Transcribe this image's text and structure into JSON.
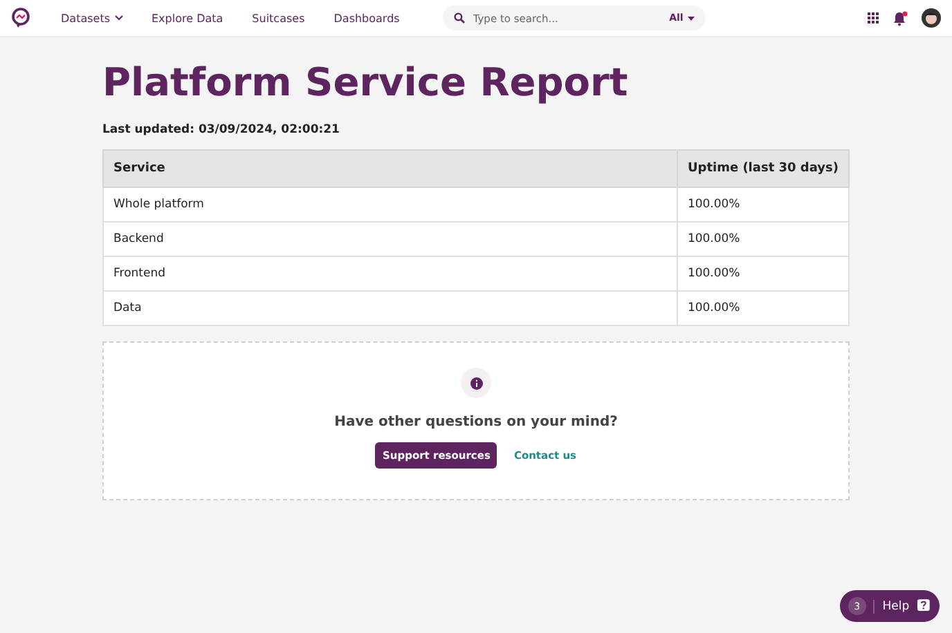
{
  "nav": {
    "items": [
      {
        "label": "Datasets",
        "dropdown": true
      },
      {
        "label": "Explore Data",
        "dropdown": false
      },
      {
        "label": "Suitcases",
        "dropdown": false
      },
      {
        "label": "Dashboards",
        "dropdown": false
      }
    ],
    "search": {
      "placeholder": "Type to search...",
      "scope": "All"
    }
  },
  "title": "Platform Service Report",
  "updated": "Last updated: 03/09/2024, 02:00:21",
  "table": {
    "columns": [
      "Service",
      "Uptime (last 30 days)"
    ],
    "rows": [
      [
        "Whole platform",
        "100.00%"
      ],
      [
        "Backend",
        "100.00%"
      ],
      [
        "Frontend",
        "100.00%"
      ],
      [
        "Data",
        "100.00%"
      ]
    ]
  },
  "help_card": {
    "question": "Have other questions on your mind?",
    "primary": "Support resources",
    "link": "Contact us"
  },
  "help_button": {
    "count": "3",
    "label": "Help"
  }
}
